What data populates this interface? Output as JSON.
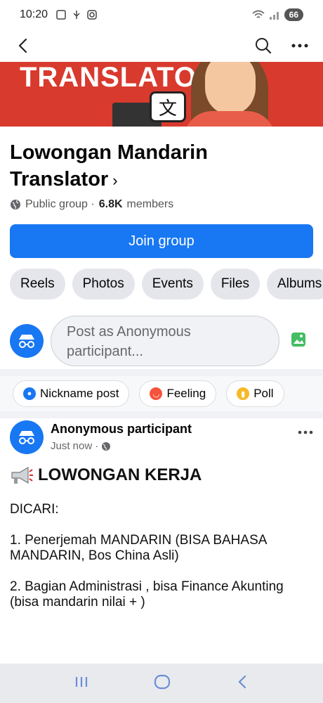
{
  "status": {
    "time": "10:20",
    "battery": "66"
  },
  "cover": {
    "text": "TRANSLATOR",
    "glyph": "文"
  },
  "group": {
    "name": "Lowongan Mandarin Translator",
    "chevron": "›",
    "privacy": "Public group · ",
    "member_count": "6.8K",
    "member_label": " members",
    "join_label": "Join group"
  },
  "tabs": [
    "Reels",
    "Photos",
    "Events",
    "Files",
    "Albums"
  ],
  "composer": {
    "placeholder": "Post as Anonymous participant..."
  },
  "actions": [
    {
      "label": "Nickname post",
      "icon": "nickname-icon",
      "color": "#1877f2"
    },
    {
      "label": "Feeling",
      "icon": "feeling-icon",
      "color": "#f5533d"
    },
    {
      "label": "Poll",
      "icon": "poll-icon",
      "color": "#f7b928"
    }
  ],
  "post": {
    "author": "Anonymous participant",
    "time": "Just now · ",
    "heading": "LOWONGAN KERJA",
    "lines": [
      "DICARI:",
      "1. Penerjemah MANDARIN (BISA BAHASA MANDARIN, Bos China Asli)",
      "2. Bagian Administrasi , bisa Finance Akunting (bisa mandarin nilai + )"
    ]
  },
  "colors": {
    "brand": "#1877f2",
    "cover_red": "#d83a2e"
  }
}
